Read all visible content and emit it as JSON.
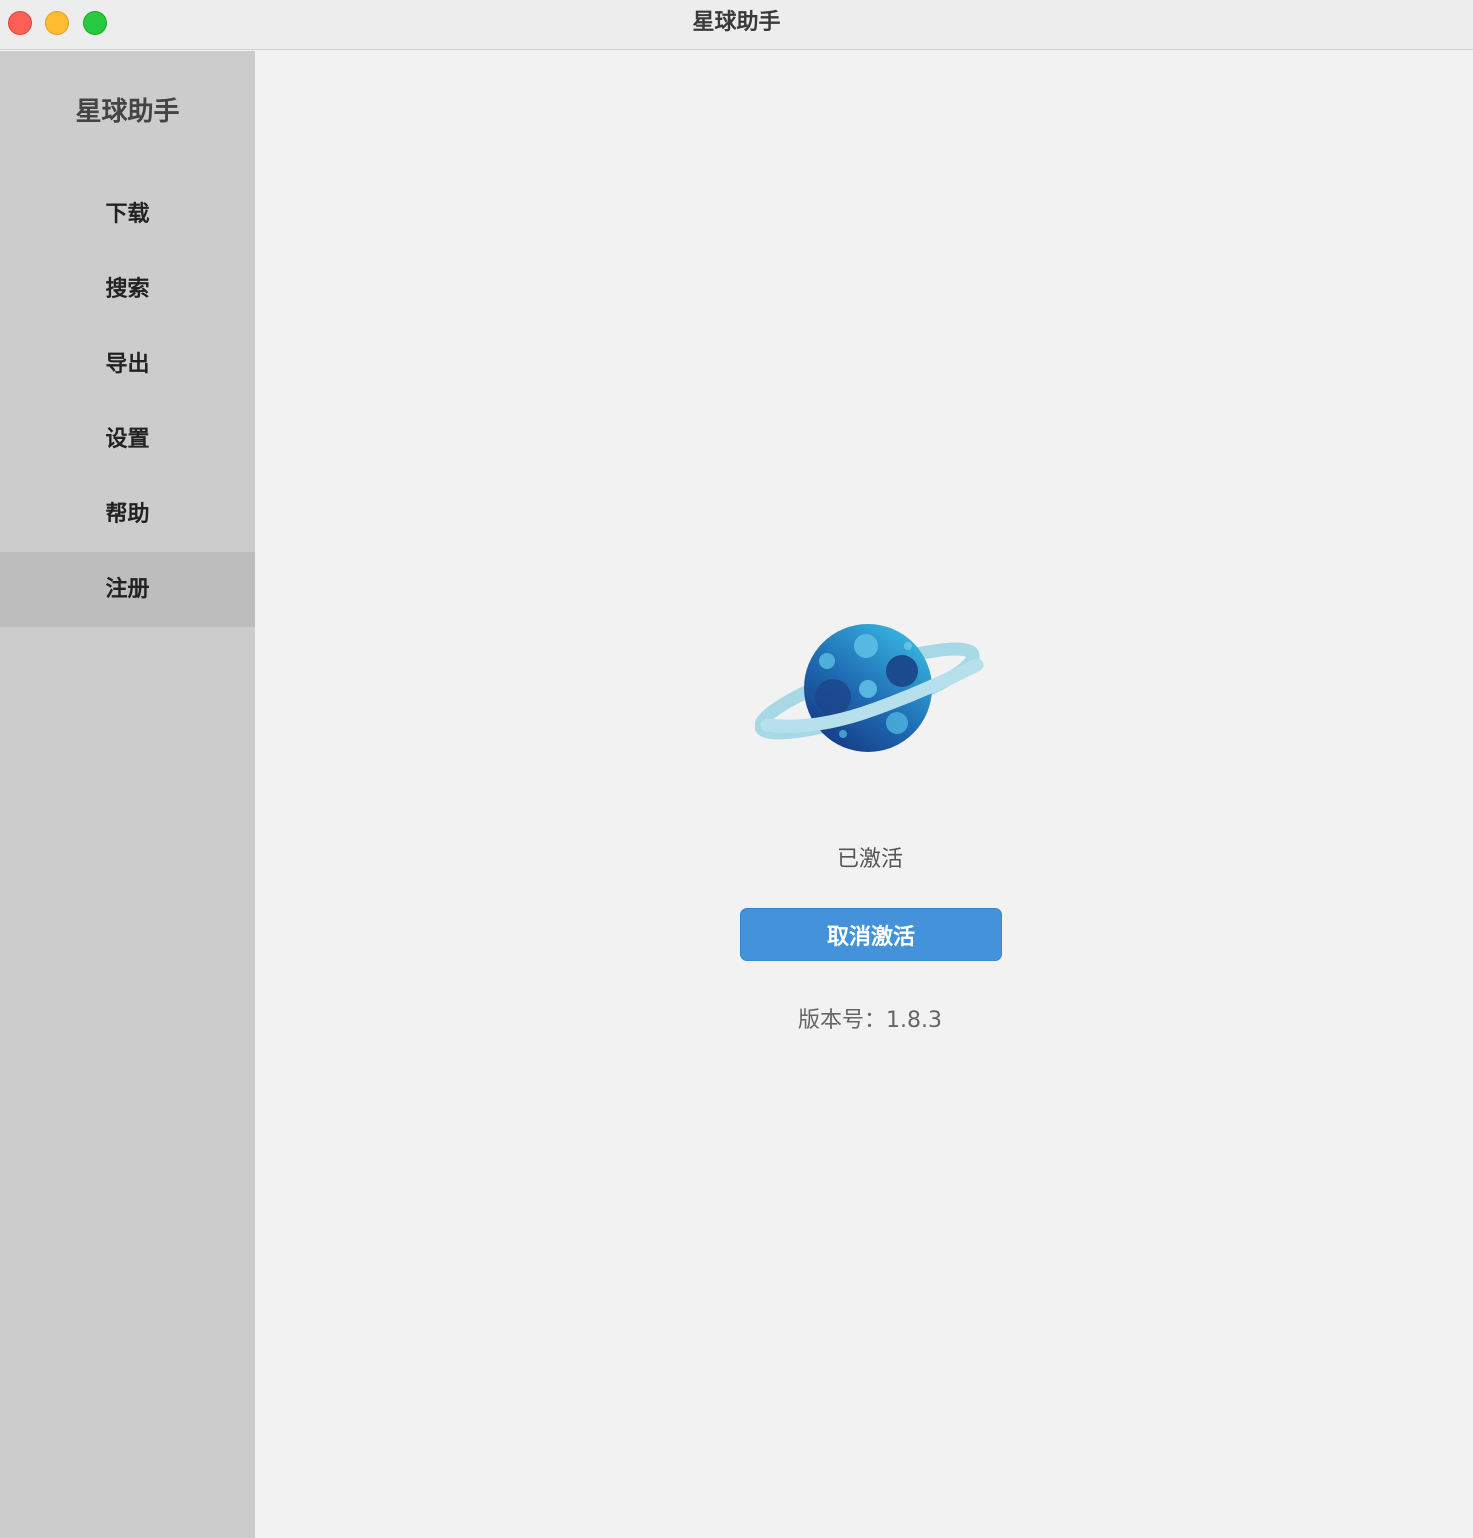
{
  "window": {
    "title": "星球助手"
  },
  "sidebar": {
    "title": "星球助手",
    "items": [
      {
        "label": "下载"
      },
      {
        "label": "搜索"
      },
      {
        "label": "导出"
      },
      {
        "label": "设置"
      },
      {
        "label": "帮助"
      },
      {
        "label": "注册",
        "active": true
      }
    ]
  },
  "main": {
    "icon": "planet-icon",
    "status": "已激活",
    "deactivate_label": "取消激活",
    "version_label": "版本号：1.8.3"
  },
  "colors": {
    "accent": "#4492d9",
    "sidebar_bg": "#cccccc",
    "sidebar_active": "#bdbdbd",
    "content_bg": "#f2f2f2"
  }
}
